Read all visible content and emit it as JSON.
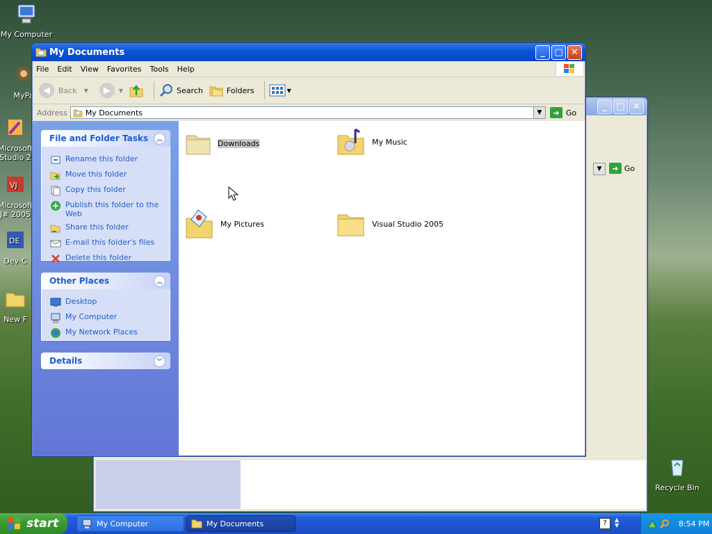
{
  "desktop": {
    "icons": [
      {
        "label": "My Computer"
      },
      {
        "label": "MyPa"
      },
      {
        "label": "Microsoft Studio 2"
      },
      {
        "label": "Microsoft J# 2005"
      },
      {
        "label": "Dev-C"
      },
      {
        "label": "New F"
      },
      {
        "label": "Recycle Bin"
      }
    ]
  },
  "background_window": {
    "go_label": "Go"
  },
  "window": {
    "title": "My Documents",
    "menu": [
      "File",
      "Edit",
      "View",
      "Favorites",
      "Tools",
      "Help"
    ],
    "toolbar": {
      "back_label": "Back",
      "search_label": "Search",
      "folders_label": "Folders"
    },
    "address": {
      "label": "Address",
      "value": "My Documents",
      "go_label": "Go"
    },
    "panels": {
      "tasks": {
        "title": "File and Folder Tasks",
        "items": [
          {
            "label": "Rename this folder",
            "icon": "rename-icon"
          },
          {
            "label": "Move this folder",
            "icon": "move-icon"
          },
          {
            "label": "Copy this folder",
            "icon": "copy-icon"
          },
          {
            "label": "Publish this folder to the Web",
            "icon": "publish-icon"
          },
          {
            "label": "Share this folder",
            "icon": "share-icon"
          },
          {
            "label": "E-mail this folder's files",
            "icon": "email-icon"
          },
          {
            "label": "Delete this folder",
            "icon": "delete-icon"
          }
        ]
      },
      "places": {
        "title": "Other Places",
        "items": [
          {
            "label": "Desktop"
          },
          {
            "label": "My Computer"
          },
          {
            "label": "My Network Places"
          }
        ]
      },
      "details": {
        "title": "Details"
      }
    },
    "files": [
      {
        "label": "Downloads",
        "selected": true
      },
      {
        "label": "My Music"
      },
      {
        "label": "My Pictures"
      },
      {
        "label": "Visual Studio 2005"
      }
    ]
  },
  "taskbar": {
    "start_label": "start",
    "buttons": [
      {
        "label": "My Computer",
        "active": false
      },
      {
        "label": "My Documents",
        "active": true
      }
    ],
    "clock": "8:54 PM"
  },
  "colors": {
    "title_active": "#0a57d8",
    "link_blue": "#215dc6",
    "start_green": "#3b9a32"
  }
}
